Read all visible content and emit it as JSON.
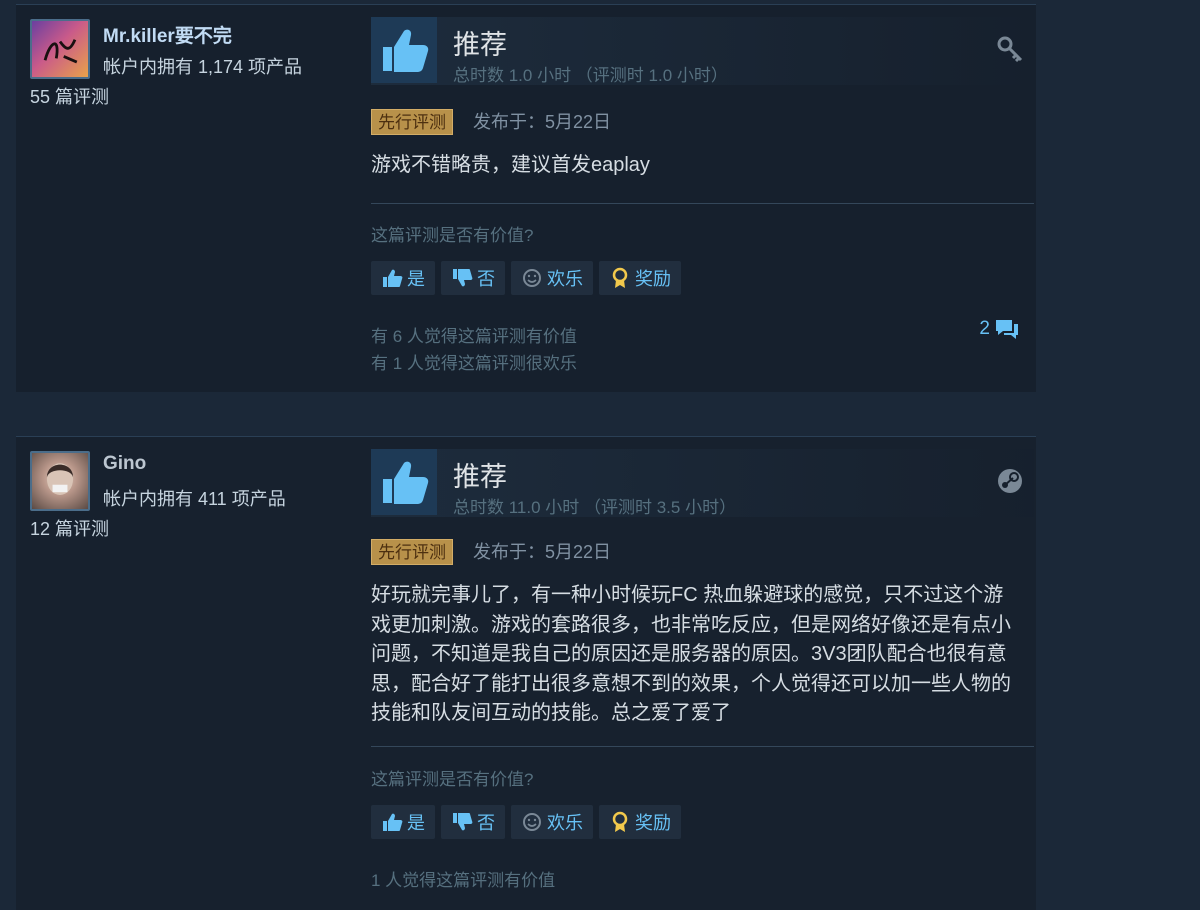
{
  "reviews": [
    {
      "user": {
        "name": "Mr.killer要不完",
        "products": "帐户内拥有 1,174 项产品",
        "reviews": "55 篇评测"
      },
      "verdict": "推荐",
      "hours": "总时数 1.0 小时 （评测时 1.0 小时）",
      "badge": "先行评测",
      "posted": "发布于：5月22日",
      "body": "游戏不错略贵，建议首发eaplay",
      "helpful_question": "这篇评测是否有价值?",
      "buttons": {
        "yes": "是",
        "no": "否",
        "funny": "欢乐",
        "award": "奖励"
      },
      "stats": [
        "有 6 人觉得这篇评测有价值",
        "有 1 人觉得这篇评测很欢乐"
      ],
      "comment_count": "2",
      "corner_icon": "key-icon"
    },
    {
      "user": {
        "name": "Gino",
        "products": "帐户内拥有 411 项产品",
        "reviews": "12 篇评测"
      },
      "verdict": "推荐",
      "hours": "总时数 11.0 小时 （评测时 3.5 小时）",
      "badge": "先行评测",
      "posted": "发布于：5月22日",
      "body": "好玩就完事儿了，有一种小时候玩FC 热血躲避球的感觉，只不过这个游戏更加刺激。游戏的套路很多，也非常吃反应，但是网络好像还是有点小问题，不知道是我自己的原因还是服务器的原因。3V3团队配合也很有意思，配合好了能打出很多意想不到的效果，个人觉得还可以加一些人物的技能和队友间互动的技能。总之爱了爱了",
      "helpful_question": "这篇评测是否有价值?",
      "buttons": {
        "yes": "是",
        "no": "否",
        "funny": "欢乐",
        "award": "奖励"
      },
      "stats": [
        "1 人觉得这篇评测有价值"
      ],
      "corner_icon": "steam-icon"
    }
  ],
  "colors": {
    "background": "#1b2838",
    "link": "#67c1f5",
    "badge": "#b8914a"
  }
}
